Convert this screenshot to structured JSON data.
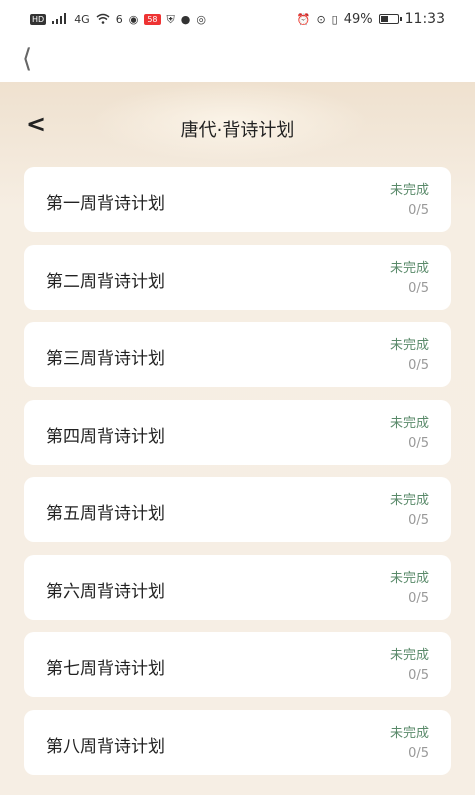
{
  "status_bar": {
    "left_badge": "HD",
    "signal_label": "4G",
    "wifi_label": "6",
    "red_badge": "58",
    "battery_percent_text": "49%",
    "battery_level": 0.49,
    "time": "11:33"
  },
  "page": {
    "title": "唐代·背诗计划"
  },
  "plans": [
    {
      "name": "第一周背诗计划",
      "status": "未完成",
      "progress": "0/5"
    },
    {
      "name": "第二周背诗计划",
      "status": "未完成",
      "progress": "0/5"
    },
    {
      "name": "第三周背诗计划",
      "status": "未完成",
      "progress": "0/5"
    },
    {
      "name": "第四周背诗计划",
      "status": "未完成",
      "progress": "0/5"
    },
    {
      "name": "第五周背诗计划",
      "status": "未完成",
      "progress": "0/5"
    },
    {
      "name": "第六周背诗计划",
      "status": "未完成",
      "progress": "0/5"
    },
    {
      "name": "第七周背诗计划",
      "status": "未完成",
      "progress": "0/5"
    },
    {
      "name": "第八周背诗计划",
      "status": "未完成",
      "progress": "0/5"
    }
  ],
  "colors": {
    "status_incomplete": "#5a8a6a",
    "background": "#f4ece0",
    "card": "#ffffff"
  }
}
